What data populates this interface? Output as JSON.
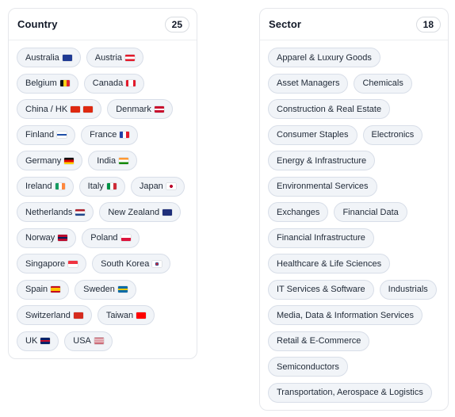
{
  "country": {
    "title": "Country",
    "count": "25",
    "items": [
      {
        "label": "Australia",
        "flag": "linear-gradient(#1f3a93,#1f3a93)",
        "flag_name": "australia-flag-icon"
      },
      {
        "label": "Austria",
        "flag": "linear-gradient(#e21b2c 0 33%,#ffffff 33% 66%,#e21b2c 66%)",
        "flag_name": "austria-flag-icon"
      },
      {
        "label": "Belgium",
        "flag": "linear-gradient(90deg,#111111 0 33%,#fcd116 33% 66%,#e2262c 66%)",
        "flag_name": "belgium-flag-icon"
      },
      {
        "label": "Canada",
        "flag": "linear-gradient(90deg,#e21b2c 0 25%,#ffffff 25% 75%,#e21b2c 75%)",
        "flag_name": "canada-flag-icon"
      },
      {
        "label": "China / HK",
        "flag": "linear-gradient(#de2910,#de2910)",
        "flag_name": "china-hk-flag-icon",
        "flag2": "linear-gradient(#de2910,#de2910)"
      },
      {
        "label": "Denmark",
        "flag": "linear-gradient(#c8102e 0 40%,#ffffff 40% 60%,#c8102e 60%)",
        "flag_name": "denmark-flag-icon"
      },
      {
        "label": "Finland",
        "flag": "linear-gradient(#ffffff 0 40%,#1f4fa8 40% 60%,#ffffff 60%)",
        "flag_name": "finland-flag-icon"
      },
      {
        "label": "France",
        "flag": "linear-gradient(90deg,#1f3fa8 0 33%,#ffffff 33% 66%,#e21b2c 66%)",
        "flag_name": "france-flag-icon"
      },
      {
        "label": "Germany",
        "flag": "linear-gradient(#111111 0 33%,#dd0000 33% 66%,#ffce00 66%)",
        "flag_name": "germany-flag-icon"
      },
      {
        "label": "India",
        "flag": "linear-gradient(#ff9933 0 33%,#ffffff 33% 66%,#138808 66%)",
        "flag_name": "india-flag-icon"
      },
      {
        "label": "Ireland",
        "flag": "linear-gradient(90deg,#169b62 0 33%,#ffffff 33% 66%,#ff883e 66%)",
        "flag_name": "ireland-flag-icon"
      },
      {
        "label": "Italy",
        "flag": "linear-gradient(90deg,#009246 0 33%,#ffffff 33% 66%,#ce2b37 66%)",
        "flag_name": "italy-flag-icon"
      },
      {
        "label": "Japan",
        "flag": "radial-gradient(circle,#bc002d 0 28%,#ffffff 30%)",
        "flag_name": "japan-flag-icon"
      },
      {
        "label": "Netherlands",
        "flag": "linear-gradient(#ae1c28 0 33%,#ffffff 33% 66%,#21468b 66%)",
        "flag_name": "netherlands-flag-icon"
      },
      {
        "label": "New Zealand",
        "flag": "linear-gradient(#1f2f7a,#1f2f7a)",
        "flag_name": "new-zealand-flag-icon"
      },
      {
        "label": "Norway",
        "flag": "linear-gradient(#ba0c2f 0 35%,#00205b 35% 65%,#ba0c2f 65%)",
        "flag_name": "norway-flag-icon"
      },
      {
        "label": "Poland",
        "flag": "linear-gradient(#ffffff 0 50%,#dc143c 50%)",
        "flag_name": "poland-flag-icon"
      },
      {
        "label": "Singapore",
        "flag": "linear-gradient(#ef3340 0 50%,#ffffff 50%)",
        "flag_name": "singapore-flag-icon"
      },
      {
        "label": "South Korea",
        "flag": "radial-gradient(circle,#cd2e3a 0 20%,#0047a0 22% 30%,#ffffff 32%)",
        "flag_name": "south-korea-flag-icon"
      },
      {
        "label": "Spain",
        "flag": "linear-gradient(#c60b1e 0 25%,#ffc400 25% 75%,#c60b1e 75%)",
        "flag_name": "spain-flag-icon"
      },
      {
        "label": "Sweden",
        "flag": "linear-gradient(#006aa7 0 40%,#fecc00 40% 60%,#006aa7 60%)",
        "flag_name": "sweden-flag-icon"
      },
      {
        "label": "Switzerland",
        "flag": "linear-gradient(#d52b1e,#d52b1e)",
        "flag_name": "switzerland-flag-icon"
      },
      {
        "label": "Taiwan",
        "flag": "linear-gradient(#fe0000,#fe0000)",
        "flag_name": "taiwan-flag-icon"
      },
      {
        "label": "UK",
        "flag": "linear-gradient(#012169 0 40%,#c8102e 40% 60%,#012169 60%)",
        "flag_name": "uk-flag-icon"
      },
      {
        "label": "USA",
        "flag": "linear-gradient(#b22234 0 15%,#ffffff 15% 30%,#b22234 30% 45%,#ffffff 45% 60%,#b22234 60% 75%,#ffffff 75% 90%,#b22234 90%)",
        "flag_name": "usa-flag-icon"
      }
    ]
  },
  "sector": {
    "title": "Sector",
    "count": "18",
    "items": [
      {
        "label": "Apparel & Luxury Goods"
      },
      {
        "label": "Asset Managers"
      },
      {
        "label": "Chemicals"
      },
      {
        "label": "Construction & Real Estate"
      },
      {
        "label": "Consumer Staples"
      },
      {
        "label": "Electronics"
      },
      {
        "label": "Energy & Infrastructure"
      },
      {
        "label": "Environmental Services"
      },
      {
        "label": "Exchanges"
      },
      {
        "label": "Financial Data"
      },
      {
        "label": "Financial Infrastructure"
      },
      {
        "label": "Healthcare & Life Sciences"
      },
      {
        "label": "IT Services & Software"
      },
      {
        "label": "Industrials"
      },
      {
        "label": "Media, Data & Information Services"
      },
      {
        "label": "Retail & E-Commerce"
      },
      {
        "label": "Semiconductors"
      },
      {
        "label": "Transportation, Aerospace & Logistics"
      }
    ]
  }
}
